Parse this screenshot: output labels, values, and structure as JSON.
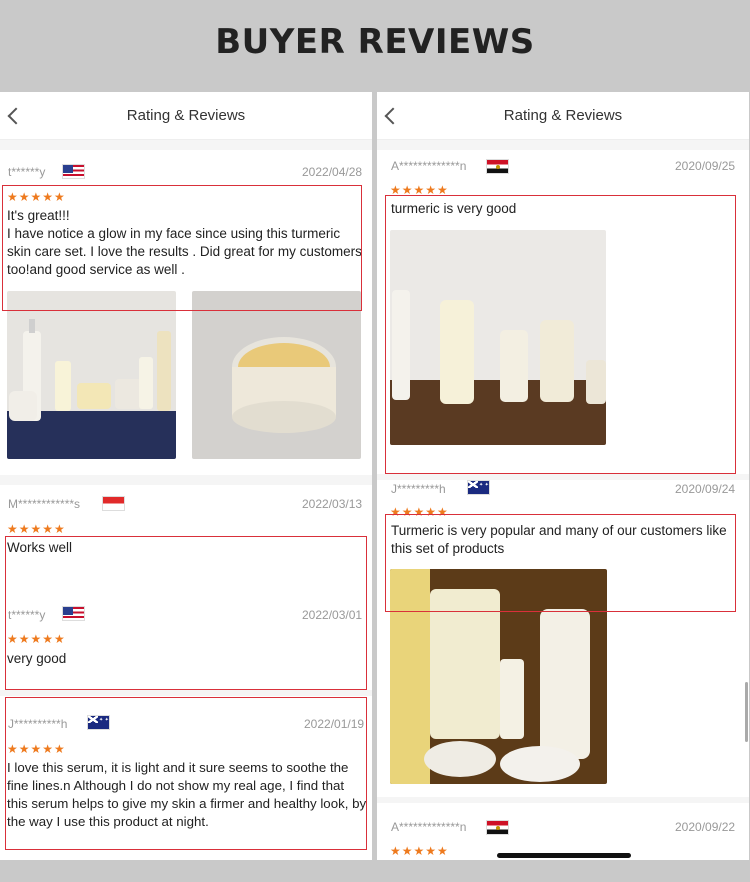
{
  "banner": {
    "title": "BUYER REVIEWS"
  },
  "left": {
    "header_title": "Rating & Reviews",
    "reviews": [
      {
        "author": "t******y",
        "country_flag": "us-flag",
        "date": "2022/04/28",
        "stars": "★★★★★",
        "title": "It's great!!!",
        "body": "I have notice a glow in my face since using this turmeric skin care set. I love the results . Did great for my customers too!and good service as well ."
      },
      {
        "author": "M************s",
        "country_flag": "indonesia-flag",
        "date": "2022/03/13",
        "stars": "★★★★★",
        "body": "Works well"
      },
      {
        "author": "t******y",
        "country_flag": "us-flag",
        "date": "2022/03/01",
        "stars": "★★★★★",
        "body": "very good"
      },
      {
        "author": "J**********h",
        "country_flag": "australia-flag",
        "date": "2022/01/19",
        "stars": "★★★★★",
        "body": "I love this serum, it is light and it sure seems to soothe the fine lines.n Although I do not show my real age, I find that this serum helps to give my skin a firmer and healthy look, by the way I use this product at night."
      }
    ]
  },
  "right": {
    "header_title": "Rating & Reviews",
    "reviews": [
      {
        "author": "A*************n",
        "country_flag": "egypt-flag",
        "date": "2020/09/25",
        "stars": "★★★★★",
        "body": "turmeric is very good"
      },
      {
        "author": "J*********h",
        "country_flag": "australia-flag",
        "date": "2020/09/24",
        "stars": "★★★★★",
        "body": "Turmeric is very popular and many of our customers like this set of products"
      },
      {
        "author": "A*************n",
        "country_flag": "egypt-flag",
        "date": "2020/09/22",
        "stars": "★★★★★"
      }
    ]
  },
  "colors": {
    "star": "#ee7a1e",
    "highlight_box": "#d9303a",
    "background": "#c9c9c9"
  }
}
